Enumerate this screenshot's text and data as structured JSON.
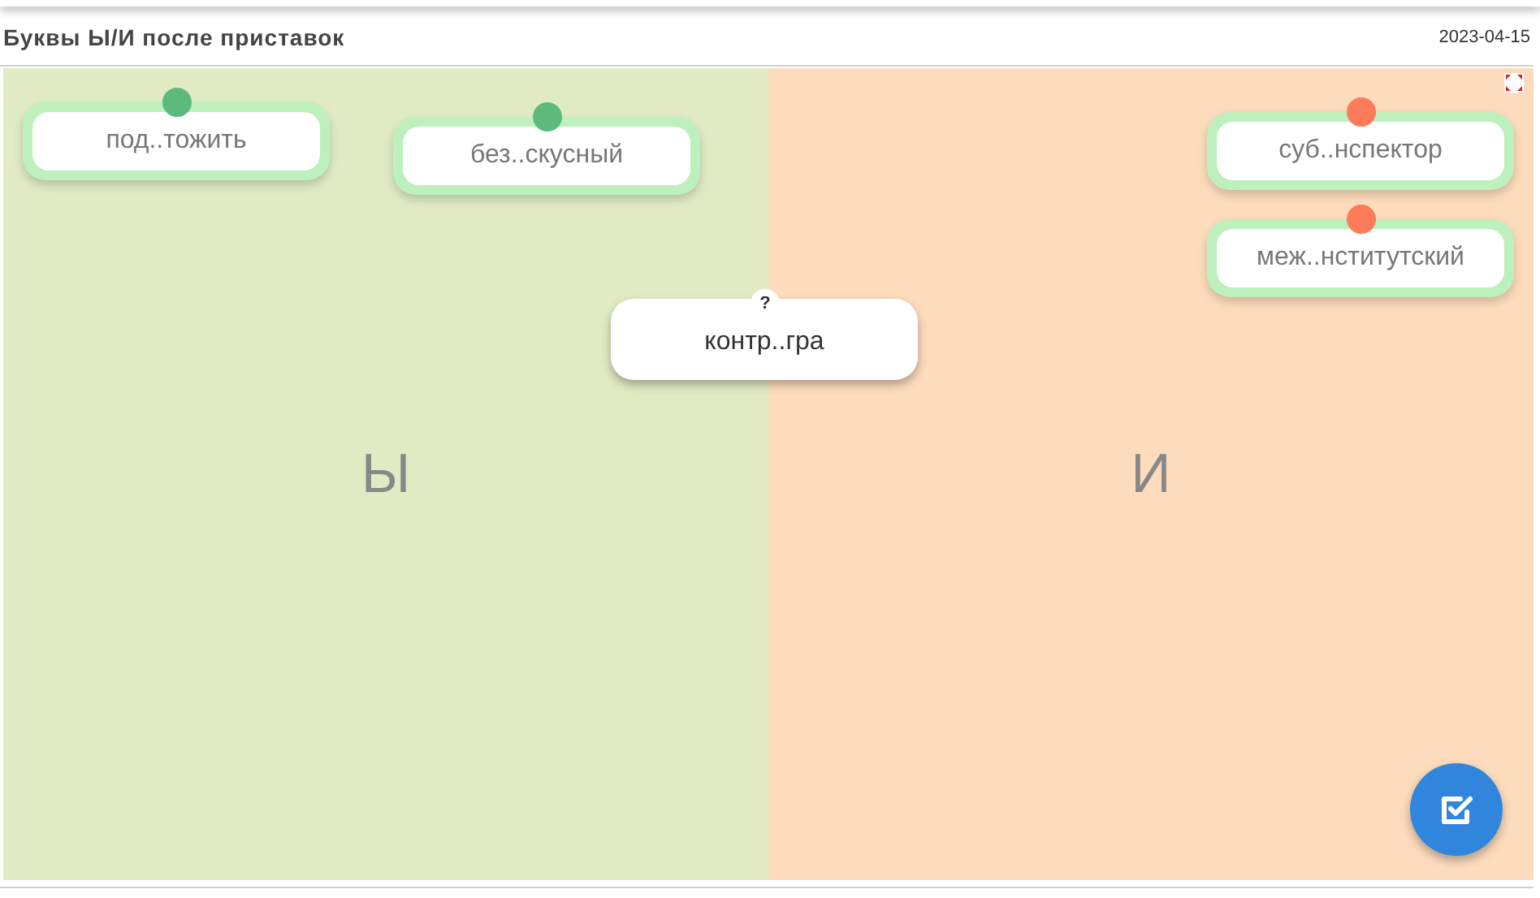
{
  "header": {
    "title": "Буквы Ы/И после приставок",
    "date": "2023-04-15"
  },
  "columns": [
    {
      "letter": "Ы",
      "color": "#e0ebc4"
    },
    {
      "letter": "И",
      "color": "#fddcbd"
    }
  ],
  "placed_cards": [
    {
      "text": "под..тожить",
      "color": "#5cba7d"
    },
    {
      "text": "без..скусный",
      "color": "#5cba7d"
    },
    {
      "text": "суб..нспектор",
      "color": "#fb7b5b"
    },
    {
      "text": "меж..нститутский",
      "color": "#fb7b5b"
    }
  ],
  "current_card": {
    "text": "контр..гра",
    "badge": "?"
  }
}
